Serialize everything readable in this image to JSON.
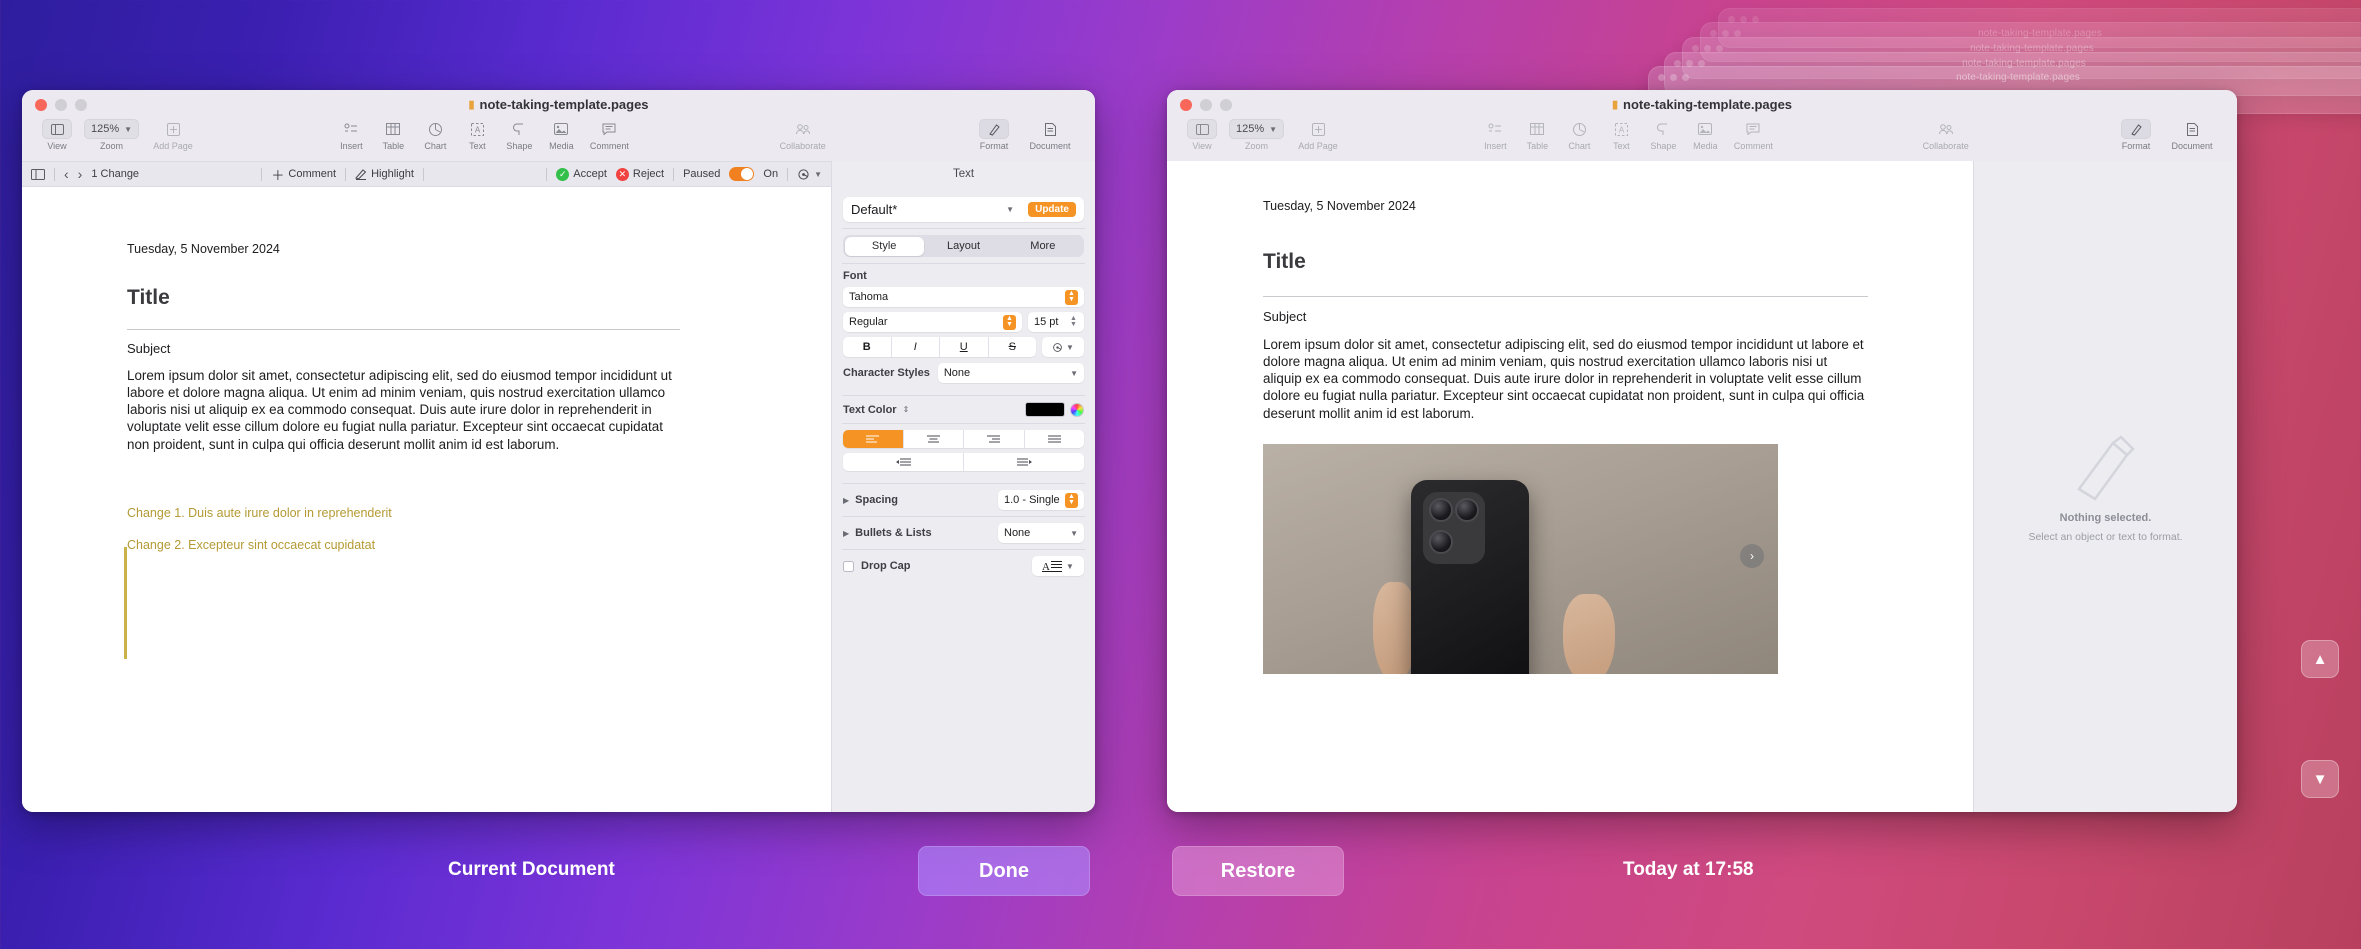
{
  "desktop": {
    "bottom_bar": {
      "current_label": "Current Document",
      "done_label": "Done",
      "restore_label": "Restore",
      "timestamp": "Today at 17:58"
    },
    "nav": {
      "up_arrow": "▲",
      "down_arrow": "▼"
    },
    "stack_title": "note-taking-template.pages"
  },
  "left_window": {
    "title": "note-taking-template.pages",
    "toolbar": {
      "view_label": "View",
      "zoom_label": "Zoom",
      "zoom_value": "125%",
      "add_page_label": "Add Page",
      "insert_label": "Insert",
      "table_label": "Table",
      "chart_label": "Chart",
      "text_label": "Text",
      "shape_label": "Shape",
      "media_label": "Media",
      "comment_label": "Comment",
      "collaborate_label": "Collaborate",
      "format_label": "Format",
      "document_label": "Document"
    },
    "review_bar": {
      "change_count": "1 Change",
      "prev_arrow": "‹",
      "next_arrow": "›",
      "comment_label": "Comment",
      "highlight_label": "Highlight",
      "accept_label": "Accept",
      "reject_label": "Reject",
      "paused_label": "Paused",
      "on_label": "On"
    },
    "document": {
      "date": "Tuesday, 5 November 2024",
      "title": "Title",
      "subject": "Subject",
      "body": "Lorem ipsum dolor sit amet, consectetur adipiscing elit, sed do eiusmod tempor incididunt ut labore et dolore magna aliqua. Ut enim ad minim veniam, quis nostrud exercitation ullamco laboris nisi ut aliquip ex ea commodo consequat. Duis aute irure dolor in reprehenderit in voluptate velit esse cillum dolore eu fugiat nulla pariatur. Excepteur sint occaecat cupidatat non proident, sunt in culpa qui officia deserunt mollit anim id est laborum.",
      "change_1": "Change 1. Duis aute irure dolor in reprehenderit",
      "change_2": "Change 2. Excepteur sint occaecat cupidatat"
    },
    "format_panel": {
      "header": "Text",
      "style_name": "Default*",
      "update_label": "Update",
      "tabs": [
        "Style",
        "Layout",
        "More"
      ],
      "active_tab": "Style",
      "font_section_label": "Font",
      "font_family": "Tahoma",
      "font_weight": "Regular",
      "font_size": "15 pt",
      "bold": "B",
      "italic": "I",
      "underline": "U",
      "strikethrough": "S",
      "character_styles_label": "Character Styles",
      "character_styles_value": "None",
      "text_color_label": "Text Color",
      "text_color_hex": "#000000",
      "spacing_label": "Spacing",
      "spacing_value": "1.0 - Single",
      "bullets_label": "Bullets & Lists",
      "bullets_value": "None",
      "drop_cap_label": "Drop Cap"
    }
  },
  "right_window": {
    "title": "note-taking-template.pages",
    "toolbar": {
      "view_label": "View",
      "zoom_label": "Zoom",
      "zoom_value": "125%",
      "add_page_label": "Add Page",
      "insert_label": "Insert",
      "table_label": "Table",
      "chart_label": "Chart",
      "text_label": "Text",
      "shape_label": "Shape",
      "media_label": "Media",
      "comment_label": "Comment",
      "collaborate_label": "Collaborate",
      "format_label": "Format",
      "document_label": "Document"
    },
    "document": {
      "date": "Tuesday, 5 November 2024",
      "title": "Title",
      "subject": "Subject",
      "body": "Lorem ipsum dolor sit amet, consectetur adipiscing elit, sed do eiusmod tempor incididunt ut labore et dolore magna aliqua. Ut enim ad minim veniam, quis nostrud exercitation ullamco laboris nisi ut aliquip ex ea commodo consequat. Duis aute irure dolor in reprehenderit in voluptate velit esse cillum dolore eu fugiat nulla pariatur. Excepteur sint occaecat cupidatat non proident, sunt in culpa qui officia deserunt mollit anim id est laborum.",
      "image_next_arrow": "›"
    },
    "format_panel": {
      "empty_title": "Nothing selected.",
      "empty_subtitle": "Select an object or text to format."
    }
  },
  "colors": {
    "accent_orange": "#f59324",
    "accept_green": "#32c04b",
    "reject_red": "#f0433f",
    "change_gold": "#b59a34"
  }
}
